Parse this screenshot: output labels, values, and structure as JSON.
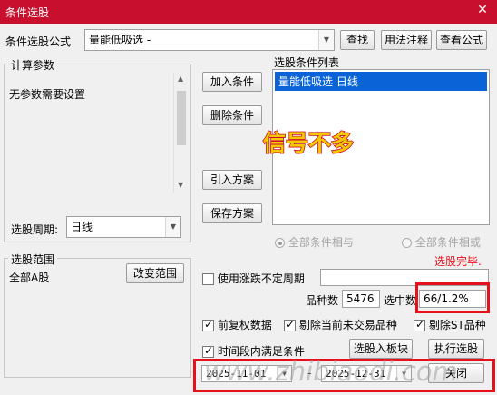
{
  "window": {
    "title": "条件选股",
    "close_glyph": "✕"
  },
  "formula": {
    "label": "条件选股公式",
    "value": "量能低吸选  -",
    "buttons": {
      "find": "查找",
      "usage": "用法注释",
      "view": "查看公式"
    }
  },
  "params": {
    "group_label": "计算参数",
    "message": "无参数需要设置"
  },
  "period": {
    "label": "选股周期:",
    "value": "日线"
  },
  "actions": {
    "add": "加入条件",
    "delete": "删除条件",
    "import_plan": "引入方案",
    "save_plan": "保存方案"
  },
  "conditions": {
    "label": "选股条件列表",
    "items": [
      "量能低吸选  日线"
    ]
  },
  "overlay_text": "信号不多",
  "logic": {
    "and_label": "全部条件相与",
    "or_label": "全部条件相或",
    "and_selected": true,
    "or_selected": false
  },
  "status": {
    "text": "选股完毕."
  },
  "range": {
    "group_label": "选股范围",
    "value": "全部A股",
    "change_button": "改变范围"
  },
  "variable_period": {
    "label": "使用涨跌不定周期",
    "checked": false
  },
  "stats": {
    "count_label": "品种数",
    "count_value": "5476",
    "selected_label": "选中数",
    "selected_value": "66/1.2%"
  },
  "options": {
    "fq": {
      "label": "前复权数据",
      "checked": true
    },
    "exclude_untraded": {
      "label": "剔除当前未交易品种",
      "checked": true
    },
    "exclude_st": {
      "label": "剔除ST品种",
      "checked": true
    },
    "time_range": {
      "label": "时间段内满足条件",
      "checked": true
    }
  },
  "bottom_buttons": {
    "to_block": "选股入板块",
    "execute": "执行选股",
    "close": "关闭"
  },
  "dates": {
    "start": "2025-11-01",
    "separator": "-",
    "end": "2025-12-31"
  },
  "watermark": "www.zhibiaodi.com",
  "colors": {
    "titlebar": "#c8102e",
    "highlight": "#e5111d",
    "selection": "#0a64d8",
    "overlay_fill": "#f5c800"
  }
}
